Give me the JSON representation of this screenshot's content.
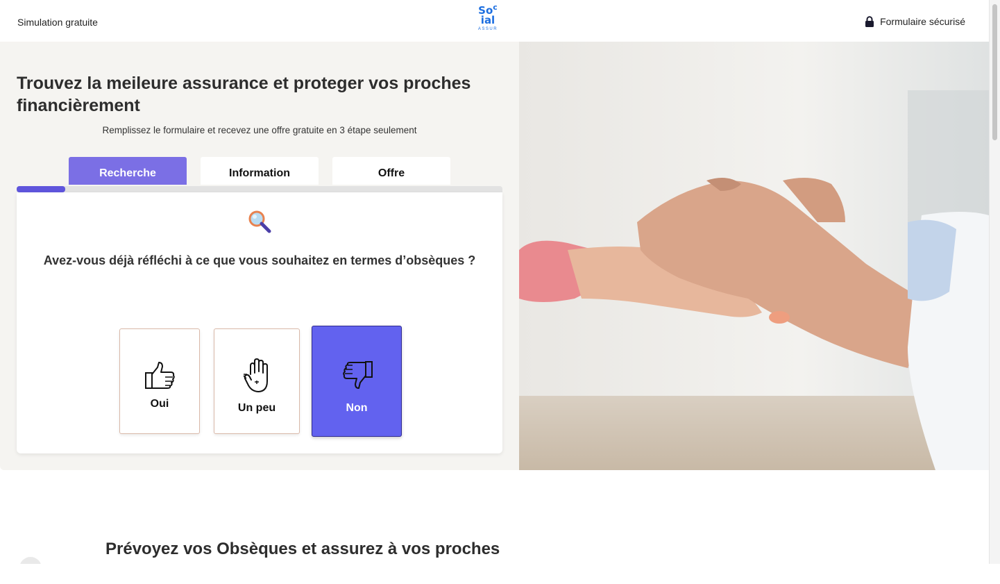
{
  "header": {
    "simulation_label": "Simulation gratuite",
    "logo": {
      "line1": "So",
      "line1b": "c",
      "line2": "ial",
      "sub": "ASSUR"
    },
    "secure_label": "Formulaire sécurisé"
  },
  "hero": {
    "headline": "Trouvez la meileure assurance et proteger vos proches financièrement",
    "subline": "Remplissez le formulaire et recevez une offre gratuite en 3 étape seulement",
    "tabs": [
      {
        "label": "Recherche",
        "active": true
      },
      {
        "label": "Information",
        "active": false
      },
      {
        "label": "Offre",
        "active": false
      }
    ],
    "progress": 0.1,
    "question": "Avez-vous déjà réfléchi à ce que vous souhaitez en termes d’obsèques ?",
    "options": [
      {
        "label": "Oui",
        "icon": "thumbs-up-icon",
        "selected": false
      },
      {
        "label": "Un peu",
        "icon": "hand-wave-icon",
        "selected": false
      },
      {
        "label": "Non",
        "icon": "thumbs-down-icon",
        "selected": true
      }
    ]
  },
  "section": {
    "title": "Prévoyez vos Obsèques et assurez à vos proches"
  },
  "colors": {
    "accent": "#6262ef",
    "tab_active": "#7b6fe5",
    "progress": "#5f55dc",
    "logo_blue": "#1d6fe0",
    "hero_bg": "#f5f4f1"
  }
}
